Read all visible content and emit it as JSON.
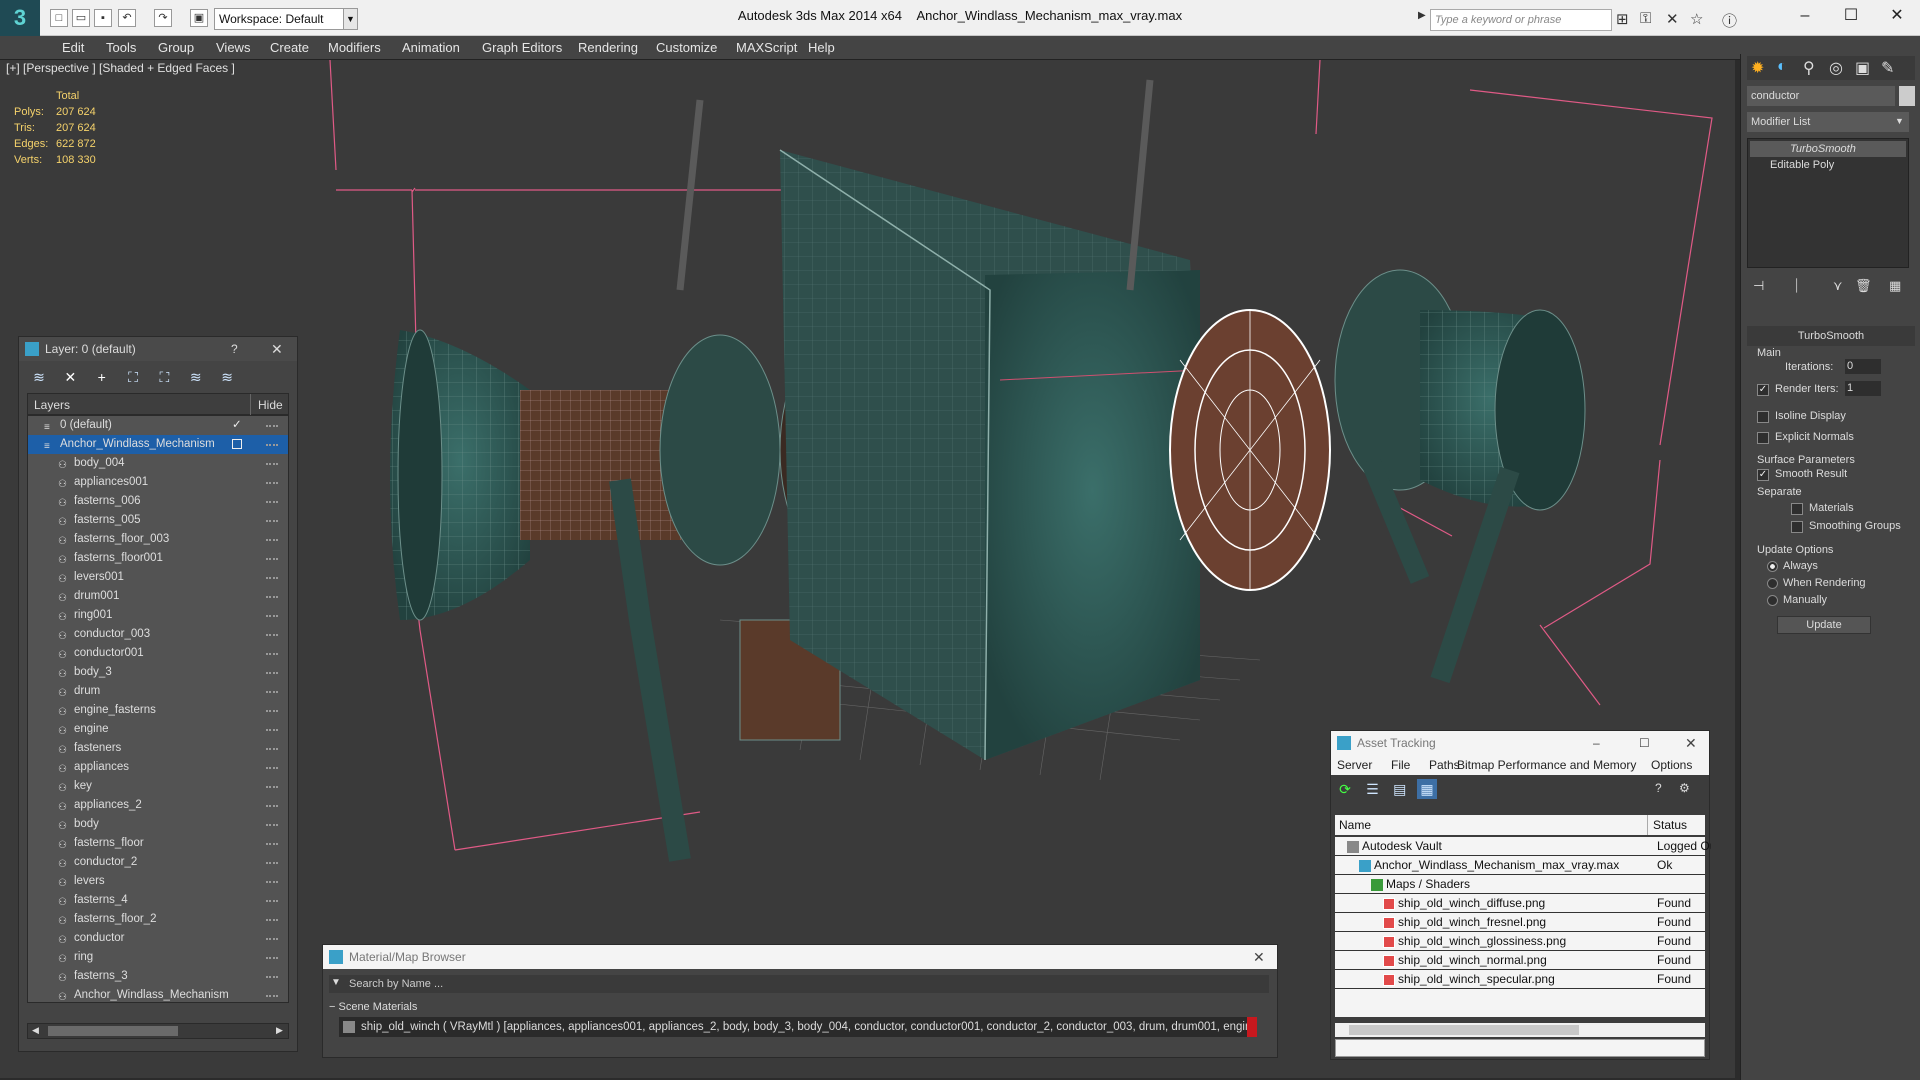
{
  "app": {
    "title": "Autodesk 3ds Max  2014 x64",
    "file": "Anchor_Windlass_Mechanism_max_vray.max",
    "workspace": "Workspace: Default",
    "search_placeholder": "Type a keyword or phrase"
  },
  "menu": [
    "Edit",
    "Tools",
    "Group",
    "Views",
    "Create",
    "Modifiers",
    "Animation",
    "Graph Editors",
    "Rendering",
    "Customize",
    "MAXScript",
    "Help"
  ],
  "viewport": {
    "label": "[+] [Perspective ] [Shaded + Edged Faces ]",
    "stats": {
      "header": "Total",
      "rows": [
        {
          "k": "Polys:",
          "v": "207 624"
        },
        {
          "k": "Tris:",
          "v": "207 624"
        },
        {
          "k": "Edges:",
          "v": "622 872"
        },
        {
          "k": "Verts:",
          "v": "108 330"
        }
      ]
    }
  },
  "layers": {
    "title": "Layer: 0 (default)",
    "help": "?",
    "col_layers": "Layers",
    "col_hide": "Hide",
    "items": [
      {
        "label": "0 (default)",
        "level": 0,
        "checked": true
      },
      {
        "label": "Anchor_Windlass_Mechanism",
        "level": 0,
        "selected": true
      },
      {
        "label": "body_004",
        "level": 1
      },
      {
        "label": "appliances001",
        "level": 1
      },
      {
        "label": "fasterns_006",
        "level": 1
      },
      {
        "label": "fasterns_005",
        "level": 1
      },
      {
        "label": "fasterns_floor_003",
        "level": 1
      },
      {
        "label": "fasterns_floor001",
        "level": 1
      },
      {
        "label": "levers001",
        "level": 1
      },
      {
        "label": "drum001",
        "level": 1
      },
      {
        "label": "ring001",
        "level": 1
      },
      {
        "label": "conductor_003",
        "level": 1
      },
      {
        "label": "conductor001",
        "level": 1
      },
      {
        "label": "body_3",
        "level": 1
      },
      {
        "label": "drum",
        "level": 1
      },
      {
        "label": "engine_fasterns",
        "level": 1
      },
      {
        "label": "engine",
        "level": 1
      },
      {
        "label": "fasteners",
        "level": 1
      },
      {
        "label": "appliances",
        "level": 1
      },
      {
        "label": "key",
        "level": 1
      },
      {
        "label": "appliances_2",
        "level": 1
      },
      {
        "label": "body",
        "level": 1
      },
      {
        "label": "fasterns_floor",
        "level": 1
      },
      {
        "label": "conductor_2",
        "level": 1
      },
      {
        "label": "levers",
        "level": 1
      },
      {
        "label": "fasterns_4",
        "level": 1
      },
      {
        "label": "fasterns_floor_2",
        "level": 1
      },
      {
        "label": "conductor",
        "level": 1
      },
      {
        "label": "ring",
        "level": 1
      },
      {
        "label": "fasterns_3",
        "level": 1
      },
      {
        "label": "Anchor_Windlass_Mechanism",
        "level": 1
      }
    ]
  },
  "command_panel": {
    "object_name": "conductor",
    "modifier_list": "Modifier List",
    "stack": [
      "TurboSmooth",
      "Editable Poly"
    ],
    "rollout_title": "TurboSmooth",
    "main_label": "Main",
    "iterations_label": "Iterations:",
    "iterations_value": "0",
    "render_iters_label": "Render Iters:",
    "render_iters_value": "1",
    "isoline": "Isoline Display",
    "explicit_normals": "Explicit Normals",
    "surface_params": "Surface Parameters",
    "smooth_result": "Smooth Result",
    "separate": "Separate",
    "materials": "Materials",
    "smoothing_groups": "Smoothing Groups",
    "update_options": "Update Options",
    "always": "Always",
    "when_rendering": "When Rendering",
    "manually": "Manually",
    "update_button": "Update"
  },
  "material_browser": {
    "title": "Material/Map Browser",
    "search_placeholder": "Search by Name ...",
    "group": "Scene Materials",
    "entry": "ship_old_winch  ( VRayMtl ) [appliances, appliances001, appliances_2, body, body_3, body_004, conductor, conductor001, conductor_2, conductor_003, drum, drum001, engin..."
  },
  "asset_tracking": {
    "title": "Asset Tracking",
    "menu": [
      "Server",
      "File",
      "Paths",
      "Bitmap Performance and Memory",
      "Options"
    ],
    "col_name": "Name",
    "col_status": "Status",
    "rows": [
      {
        "name": "Autodesk Vault",
        "status": "Logged Ou",
        "indent": 1,
        "icon": "vault"
      },
      {
        "name": "Anchor_Windlass_Mechanism_max_vray.max",
        "status": "Ok",
        "indent": 2,
        "icon": "max"
      },
      {
        "name": "Maps / Shaders",
        "status": "",
        "indent": 3,
        "icon": "maps"
      },
      {
        "name": "ship_old_winch_diffuse.png",
        "status": "Found",
        "indent": 4,
        "icon": "png"
      },
      {
        "name": "ship_old_winch_fresnel.png",
        "status": "Found",
        "indent": 4,
        "icon": "png"
      },
      {
        "name": "ship_old_winch_glossiness.png",
        "status": "Found",
        "indent": 4,
        "icon": "png"
      },
      {
        "name": "ship_old_winch_normal.png",
        "status": "Found",
        "indent": 4,
        "icon": "png"
      },
      {
        "name": "ship_old_winch_specular.png",
        "status": "Found",
        "indent": 4,
        "icon": "png"
      }
    ]
  },
  "colors": {
    "bbox": "#e05a86",
    "model_teal": "#2f5a55",
    "rust": "#8a4a2e",
    "selection": "#1d5fa8",
    "stats": "#f5d26b"
  }
}
